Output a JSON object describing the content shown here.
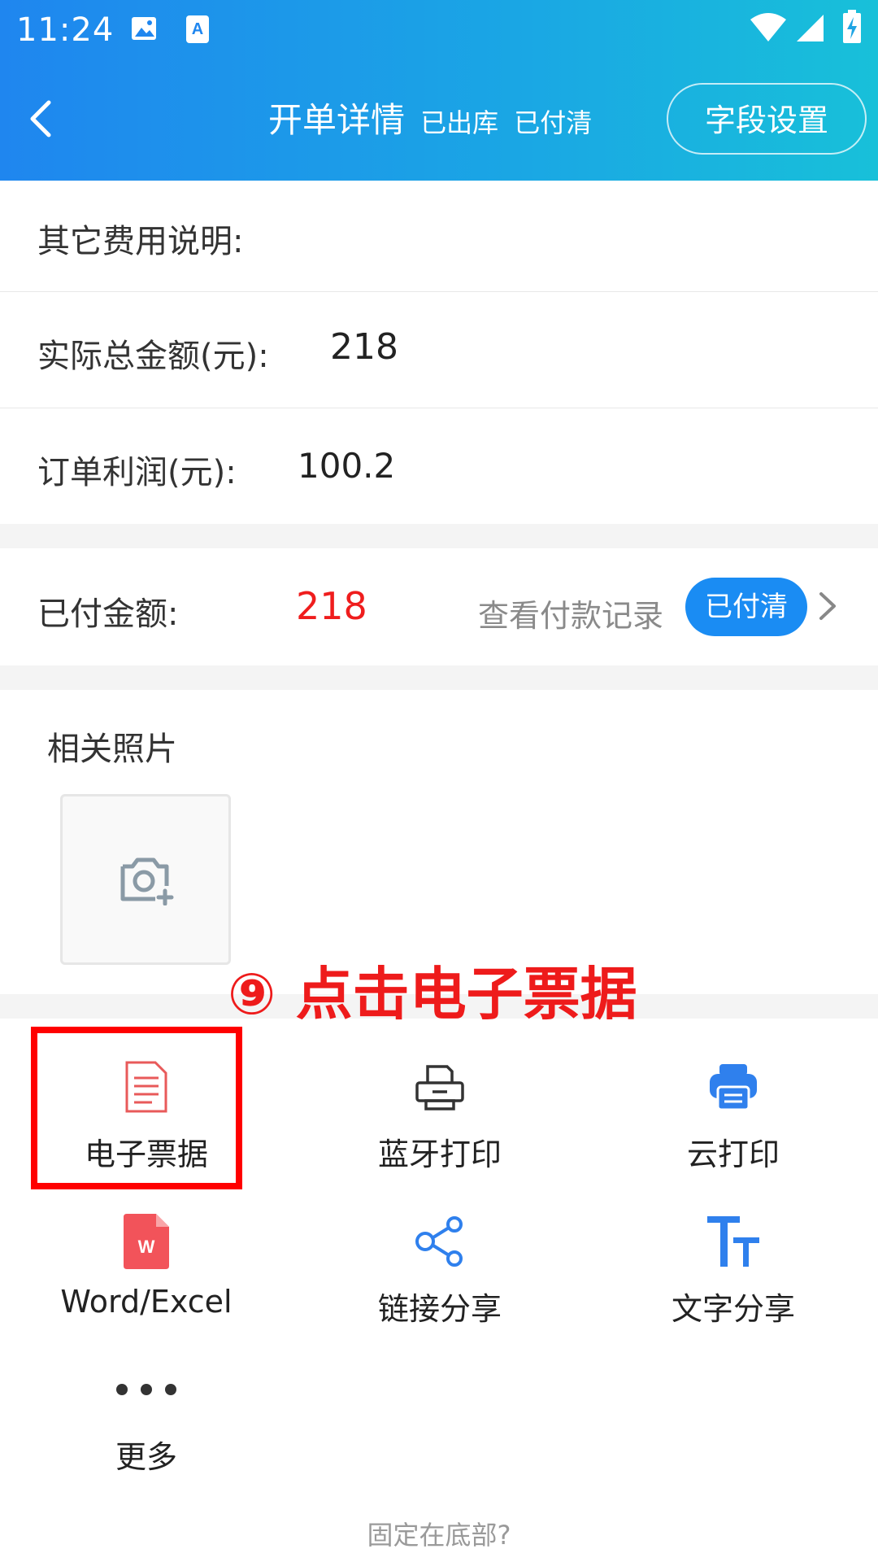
{
  "status_bar": {
    "time": "11:24",
    "icons": [
      "image-icon",
      "a-keyboard-icon",
      "wifi-icon",
      "signal-icon",
      "battery-charging-icon"
    ]
  },
  "header": {
    "title": "开单详情",
    "status_out": "已出库",
    "status_paid": "已付清",
    "field_settings": "字段设置"
  },
  "fields": {
    "other_fee_label": "其它费用说明:",
    "actual_total_label": "实际总金额(元):",
    "actual_total_value": "218",
    "profit_label": "订单利润(元):",
    "profit_value": "100.2"
  },
  "payment": {
    "paid_label": "已付金额:",
    "paid_value": "218",
    "view_records": "查看付款记录",
    "badge": "已付清"
  },
  "photos": {
    "title": "相关照片"
  },
  "annotation": {
    "text": "⑨ 点击电子票据",
    "color": "#ee1b1b"
  },
  "actions": {
    "e_receipt": "电子票据",
    "bluetooth_print": "蓝牙打印",
    "cloud_print": "云打印",
    "word_excel": "Word/Excel",
    "link_share": "链接分享",
    "text_share": "文字分享",
    "more": "更多"
  },
  "footer": {
    "pin_bottom": "固定在底部?"
  },
  "colors": {
    "accent": "#1a8cf3",
    "paid_red": "#ef1d1d",
    "receipt_icon": "#e85a5a",
    "wps_red": "#f2535a"
  }
}
